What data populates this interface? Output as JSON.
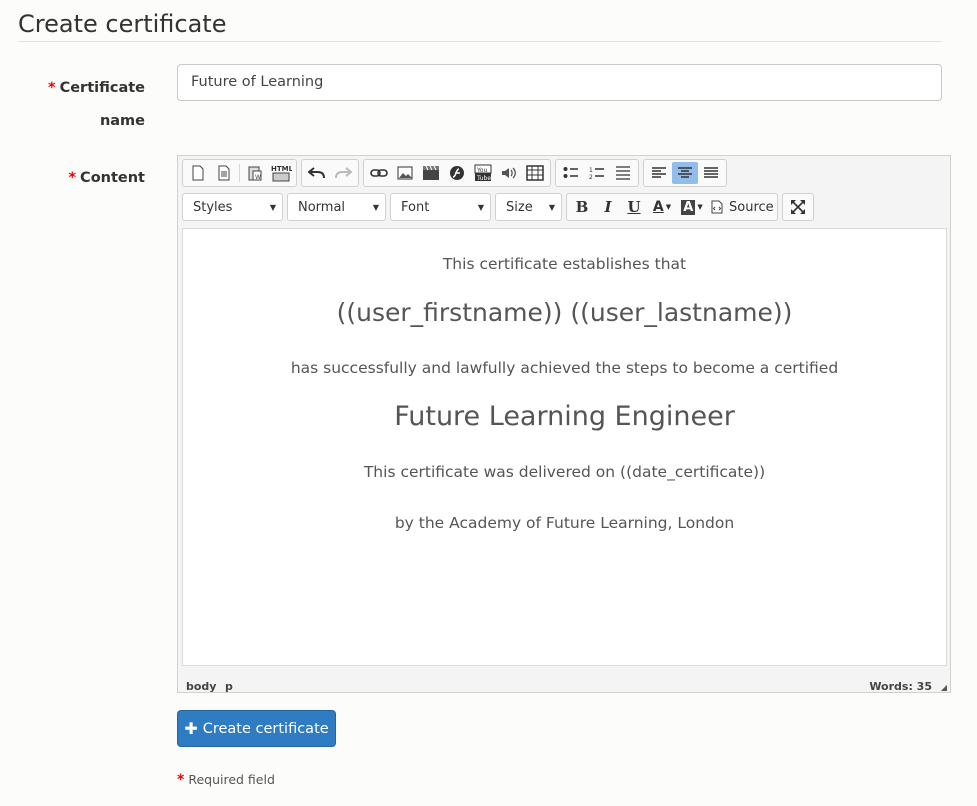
{
  "page": {
    "title": "Create certificate"
  },
  "form": {
    "name_label": "Certificate name",
    "name_label_line1": "Certificate",
    "name_label_line2": "name",
    "name_value": "Future of Learning",
    "content_label": "Content",
    "required_mark": "*"
  },
  "editor": {
    "combos": {
      "styles": "Styles",
      "format": "Normal",
      "font": "Font",
      "size": "Size"
    },
    "buttons": {
      "source": "Source",
      "html_icon_text": "HTML",
      "youtube_icon_text": "You Tube",
      "bold": "B",
      "italic": "I",
      "underline": "U",
      "text_color": "A",
      "bg_color": "A"
    },
    "content": {
      "line1": "This certificate establishes that",
      "line2": "((user_firstname)) ((user_lastname))",
      "line3": "has successfully and lawfully achieved the steps to become a certified",
      "line4": "Future Learning Engineer",
      "line5": "This certificate was delivered on ((date_certificate))",
      "line6": "by the Academy of Future Learning, London"
    },
    "status": {
      "path_body": "body",
      "path_p": "p",
      "words": "Words: 35"
    }
  },
  "actions": {
    "create_label": "Create certificate"
  },
  "footer": {
    "required_text": "Required field"
  },
  "colors": {
    "primary": "#2f7cc2",
    "required": "#ee0000",
    "active_tool": "#92bce9"
  }
}
